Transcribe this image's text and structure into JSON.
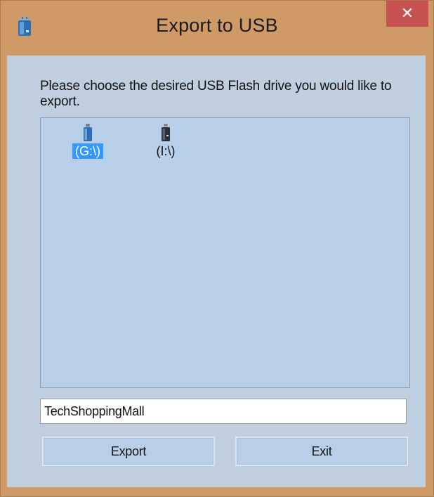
{
  "window": {
    "title": "Export to USB",
    "close_glyph": "✕",
    "icon": "usb-drive-icon"
  },
  "dialog": {
    "prompt": "Please choose the desired USB Flash drive you would like to export.",
    "drives": [
      {
        "label": "(G:\\)",
        "selected": true,
        "icon": "usb-drive-icon"
      },
      {
        "label": "(I:\\)",
        "selected": false,
        "icon": "usb-drive-icon"
      }
    ],
    "name_input": {
      "value": "TechShoppingMall"
    },
    "export_label": "Export",
    "exit_label": "Exit"
  },
  "colors": {
    "window_frame": "#d09a66",
    "client_background": "#c0cfe0",
    "list_background": "#b7cfe9",
    "selection": "#3399ff",
    "close_button": "#c75050"
  }
}
